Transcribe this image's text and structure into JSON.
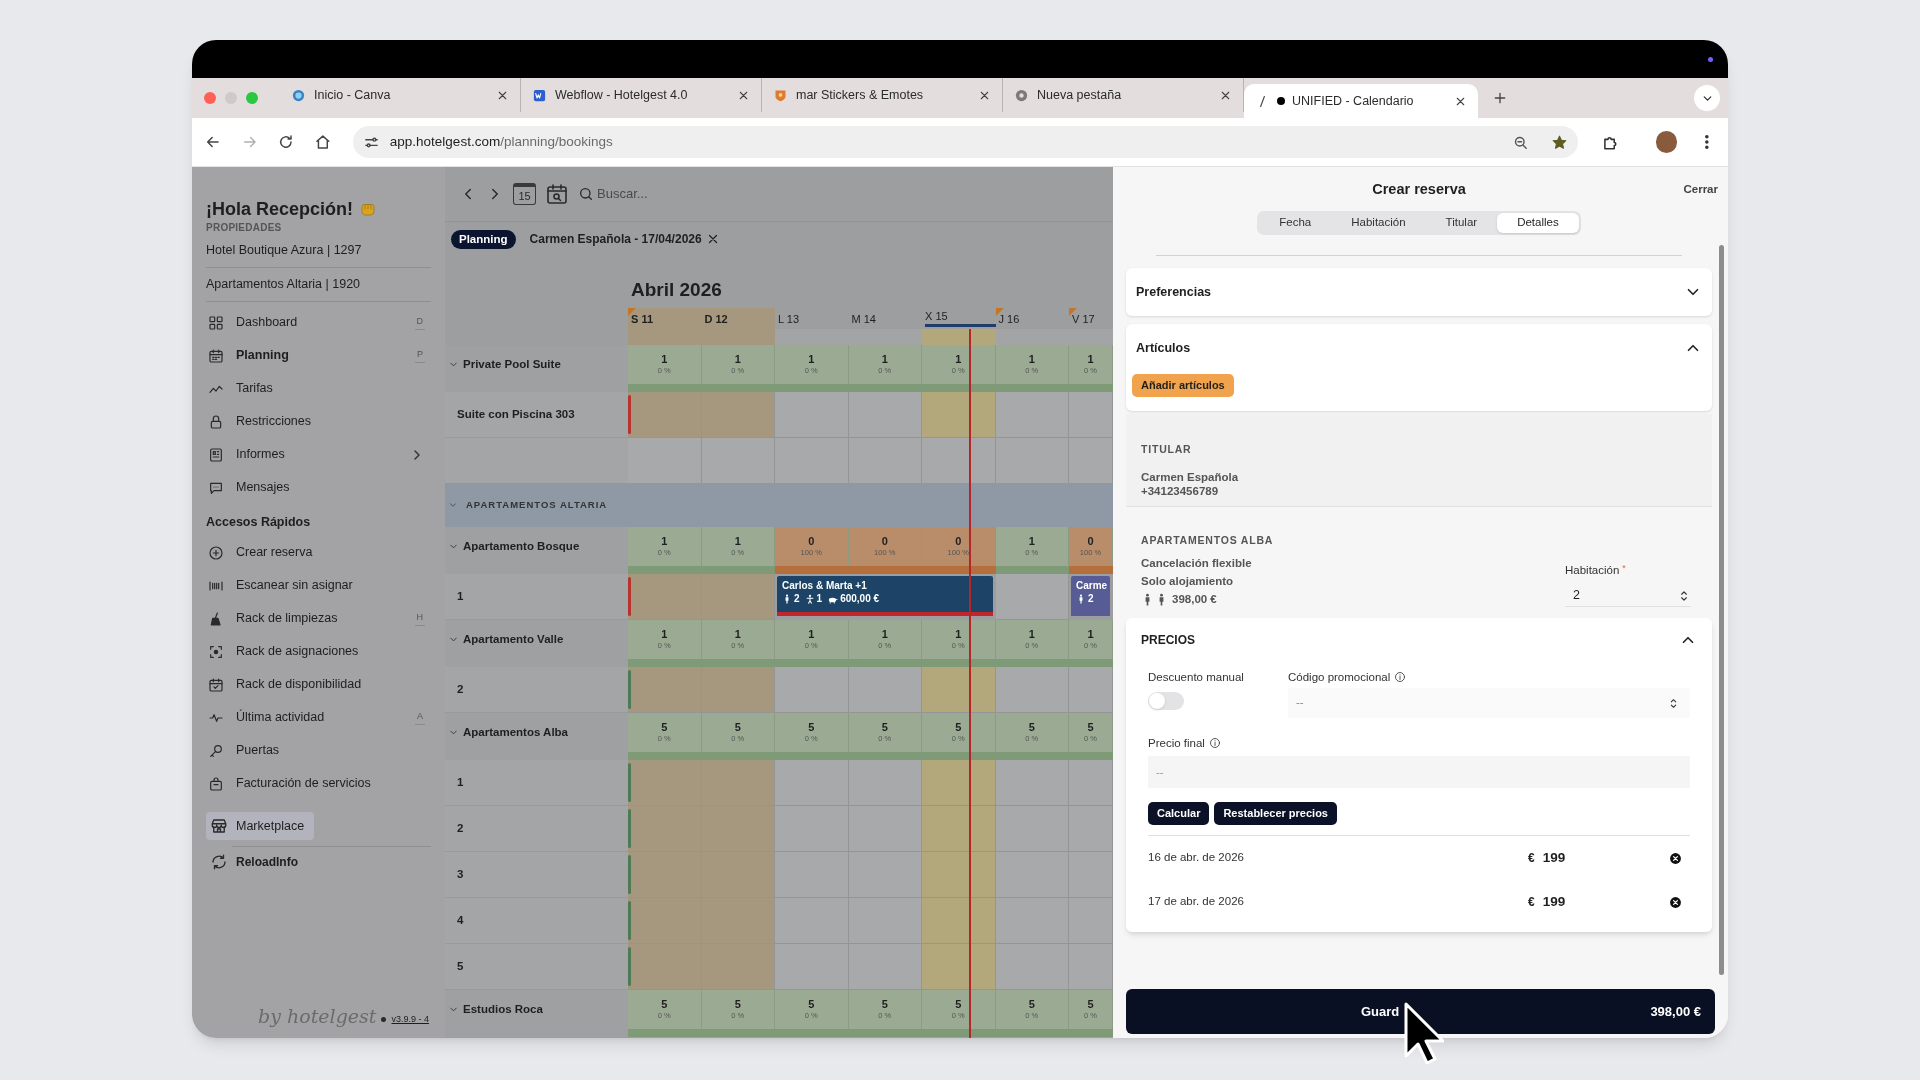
{
  "browser": {
    "tabs": [
      {
        "title": "Inicio - Canva",
        "selected": false,
        "recording": false
      },
      {
        "title": "Webflow - Hotelgest 4.0",
        "selected": false,
        "recording": false
      },
      {
        "title": "mar Stickers & Emotes",
        "selected": false,
        "recording": false
      },
      {
        "title": "Nueva pestaña",
        "selected": false,
        "recording": false
      },
      {
        "title": "UNIFIED - Calendario",
        "selected": true,
        "recording": true
      }
    ],
    "url": {
      "host": "app.hotelgest.com",
      "path": "/planning/bookings"
    }
  },
  "sidebar": {
    "greeting": "¡Hola Recepción!",
    "properties_heading": "PROPIEDADES",
    "properties": [
      "Hotel Boutique Azura | 1297",
      "Apartamentos Altaria | 1920"
    ],
    "nav": [
      {
        "label": "Dashboard",
        "shortcut": "D",
        "selected": false,
        "kind": "link"
      },
      {
        "label": "Planning",
        "shortcut": "P",
        "selected": true,
        "kind": "link"
      },
      {
        "label": "Tarifas",
        "selected": false,
        "kind": "link"
      },
      {
        "label": "Restricciones",
        "selected": false,
        "kind": "link"
      },
      {
        "label": "Informes",
        "selected": false,
        "kind": "submenu"
      },
      {
        "label": "Mensajes",
        "selected": false,
        "kind": "link"
      }
    ],
    "quick_heading": "Accesos Rápidos",
    "quick": [
      {
        "label": "Crear reserva"
      },
      {
        "label": "Escanear sin asignar"
      },
      {
        "label": "Rack de limpiezas",
        "shortcut": "H"
      },
      {
        "label": "Rack de asignaciones"
      },
      {
        "label": "Rack de disponibilidad"
      },
      {
        "label": "Última actividad",
        "shortcut": "A"
      },
      {
        "label": "Puertas"
      },
      {
        "label": "Facturación de servicios"
      }
    ],
    "marketplace": {
      "label": "Marketplace",
      "highlighted": true
    },
    "reload": "ReloadInfo",
    "brand": "by hotelgest",
    "version": "v3.9.9 - 4"
  },
  "calendar": {
    "today_icon": "15",
    "search": {
      "placeholder": "Buscar..."
    },
    "chip": "Planning",
    "filter": "Carmen Española - 17/04/2026",
    "month": "Abril 2026",
    "days": [
      {
        "label": "S 11",
        "weekend": true,
        "today": false,
        "flag": true
      },
      {
        "label": "D 12",
        "weekend": true,
        "today": false,
        "flag": false
      },
      {
        "label": "L 13",
        "weekend": false,
        "today": false,
        "flag": false
      },
      {
        "label": "M 14",
        "weekend": false,
        "today": false,
        "flag": false
      },
      {
        "label": "X 15",
        "weekend": false,
        "today": true,
        "flag": false
      },
      {
        "label": "J 16",
        "weekend": false,
        "today": false,
        "flag": true
      },
      {
        "label": "V 17",
        "weekend": false,
        "today": false,
        "flag": true
      }
    ],
    "rows": [
      {
        "kind": "summary",
        "label": "Private Pool Suite",
        "expanded": true,
        "cells": [
          {
            "count": "1",
            "share": "0 %",
            "full": false
          },
          {
            "count": "1",
            "share": "0 %",
            "full": false
          },
          {
            "count": "1",
            "share": "0 %",
            "full": false
          },
          {
            "count": "1",
            "share": "0 %",
            "full": false
          },
          {
            "count": "1",
            "share": "0 %",
            "full": false
          },
          {
            "count": "1",
            "share": "0 %",
            "full": false
          },
          {
            "count": "1",
            "share": "0 %",
            "full": false
          }
        ]
      },
      {
        "kind": "room",
        "label": "Suite con Piscina 303",
        "color": "#b8322e"
      },
      {
        "kind": "spacer"
      },
      {
        "kind": "group",
        "label": "APARTAMENTOS ALTARIA",
        "expanded": true
      },
      {
        "kind": "summary",
        "label": "Apartamento Bosque",
        "expanded": true,
        "cells": [
          {
            "count": "1",
            "share": "0 %",
            "full": false
          },
          {
            "count": "1",
            "share": "0 %",
            "full": false
          },
          {
            "count": "0",
            "share": "100 %",
            "full": true
          },
          {
            "count": "0",
            "share": "100 %",
            "full": true
          },
          {
            "count": "0",
            "share": "100 %",
            "full": true
          },
          {
            "count": "1",
            "share": "0 %",
            "full": false
          },
          {
            "count": "0",
            "share": "100 %",
            "full": true
          }
        ]
      },
      {
        "kind": "room",
        "label": "1",
        "color": "#b8322e",
        "cells": [
          {
            "kind": "free"
          },
          {
            "kind": "free"
          },
          {
            "kind": "booking",
            "title": "Carlos & Marta +1",
            "adults": "2",
            "children": "1",
            "price": "600,00 €",
            "alert": true,
            "color": "#1d4466"
          },
          {
            "kind": "booked"
          },
          {
            "kind": "booked"
          },
          {
            "kind": "free"
          },
          {
            "kind": "booking",
            "title": "Carme",
            "adults": "2",
            "alert": false,
            "color": "#575c94"
          }
        ]
      },
      {
        "kind": "summary",
        "label": "Apartamento Valle",
        "expanded": true,
        "cells": [
          {
            "count": "1",
            "share": "0 %",
            "full": false
          },
          {
            "count": "1",
            "share": "0 %",
            "full": false
          },
          {
            "count": "1",
            "share": "0 %",
            "full": false
          },
          {
            "count": "1",
            "share": "0 %",
            "full": false
          },
          {
            "count": "1",
            "share": "0 %",
            "full": false
          },
          {
            "count": "1",
            "share": "0 %",
            "full": false
          },
          {
            "count": "1",
            "share": "0 %",
            "full": false
          }
        ]
      },
      {
        "kind": "room",
        "label": "2",
        "color": "#4e7a56"
      },
      {
        "kind": "summary",
        "label": "Apartamentos Alba",
        "expanded": true,
        "cells": [
          {
            "count": "5",
            "share": "0 %",
            "full": false
          },
          {
            "count": "5",
            "share": "0 %",
            "full": false
          },
          {
            "count": "5",
            "share": "0 %",
            "full": false
          },
          {
            "count": "5",
            "share": "0 %",
            "full": false
          },
          {
            "count": "5",
            "share": "0 %",
            "full": false
          },
          {
            "count": "5",
            "share": "0 %",
            "full": false
          },
          {
            "count": "5",
            "share": "0 %",
            "full": false
          }
        ]
      },
      {
        "kind": "room",
        "label": "1",
        "color": "#4e7a56"
      },
      {
        "kind": "room",
        "label": "2",
        "color": "#4e7a56"
      },
      {
        "kind": "room",
        "label": "3",
        "color": "#4e7a56"
      },
      {
        "kind": "room",
        "label": "4",
        "color": "#4e7a56"
      },
      {
        "kind": "room",
        "label": "5",
        "color": "#4e7a56"
      },
      {
        "kind": "summary",
        "label": "Estudios Roca",
        "expanded": true,
        "cells": [
          {
            "count": "5",
            "share": "0 %",
            "full": false
          },
          {
            "count": "5",
            "share": "0 %",
            "full": false
          },
          {
            "count": "5",
            "share": "0 %",
            "full": false
          },
          {
            "count": "5",
            "share": "0 %",
            "full": false
          },
          {
            "count": "5",
            "share": "0 %",
            "full": false
          },
          {
            "count": "5",
            "share": "0 %",
            "full": false
          },
          {
            "count": "5",
            "share": "0 %",
            "full": false
          }
        ]
      }
    ]
  },
  "panel": {
    "title": "Crear reserva",
    "close": "Cerrar",
    "steps": [
      {
        "label": "Fecha",
        "selected": false
      },
      {
        "label": "Habitación",
        "selected": false
      },
      {
        "label": "Titular",
        "selected": false
      },
      {
        "label": "Detalles",
        "selected": true
      }
    ],
    "sections": [
      {
        "title": "Preferencias",
        "expanded": false
      },
      {
        "title": "Artículos",
        "expanded": true,
        "button": "Añadir artículos"
      }
    ],
    "holder": {
      "heading": "TITULAR",
      "name": "Carmen Española",
      "phone": "+34123456789"
    },
    "unit": {
      "heading": "APARTAMENTOS ALBA",
      "rate": "Cancelación flexible",
      "board": "Solo alojamiento",
      "guests": [
        {
          "kind": "adult"
        },
        {
          "kind": "adult"
        }
      ],
      "price": "398,00 €",
      "room_label": "Habitación",
      "required_mark": "*",
      "room_value": "2"
    },
    "prices": {
      "title": "PRECIOS",
      "expanded": true,
      "discount_label": "Descuento manual",
      "discount_on": false,
      "promo_label": "Código promocional",
      "promo_placeholder": "--",
      "final_label": "Precio final",
      "final_placeholder": "--",
      "buttons": [
        "Calcular",
        "Restablecer precios"
      ],
      "nights": [
        {
          "date": "16 de abr. de 2026",
          "currency": "€",
          "amount": "199"
        },
        {
          "date": "17 de abr. de 2026",
          "currency": "€",
          "amount": "199"
        }
      ]
    },
    "save": {
      "label": "Guard",
      "total": "398,00 €"
    }
  }
}
